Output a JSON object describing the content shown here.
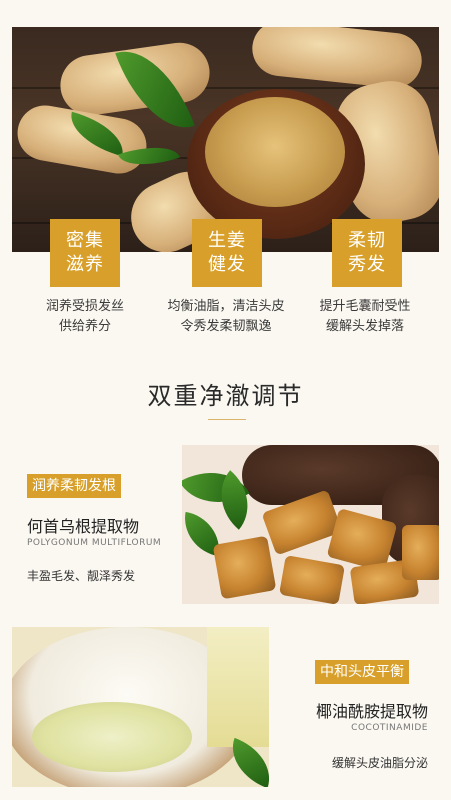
{
  "features": [
    {
      "badge_line1": "密集",
      "badge_line2": "滋养",
      "desc_line1": "润养受损发丝",
      "desc_line2": "供给养分"
    },
    {
      "badge_line1": "生姜",
      "badge_line2": "健发",
      "desc_line1": "均衡油脂，清洁头皮",
      "desc_line2": "令秀发柔韧飘逸"
    },
    {
      "badge_line1": "柔韧",
      "badge_line2": "秀发",
      "desc_line1": "提升毛囊耐受性",
      "desc_line2": "缓解头发掉落"
    }
  ],
  "section_title": "双重净澈调节",
  "ingredients": [
    {
      "tag": "润养柔韧发根",
      "name": "何首乌根提取物",
      "latin": "POLYGONUM MULTIFLORUM",
      "benefit": "丰盈毛发、靓泽秀发"
    },
    {
      "tag": "中和头皮平衡",
      "name": "椰油酰胺提取物",
      "latin": "COCOTINAMIDE",
      "benefit": "缓解头皮油脂分泌"
    }
  ],
  "colors": {
    "accent": "#d8a02a",
    "background": "#fbf8f1"
  }
}
